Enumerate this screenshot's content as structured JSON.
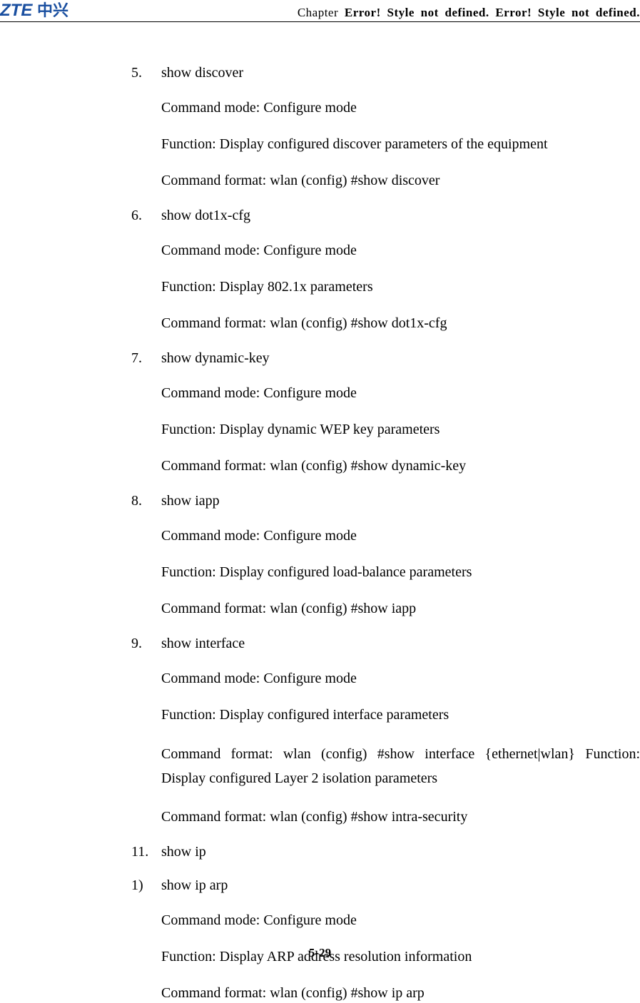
{
  "header": {
    "chapter_label": "Chapter",
    "error_text": "Error! Style not defined.  Error! Style not defined."
  },
  "items": [
    {
      "number": "5.",
      "title": "show discover",
      "lines": [
        "Command mode: Configure mode",
        "Function: Display configured discover parameters of the equipment",
        "Command format: wlan (config) #show discover"
      ]
    },
    {
      "number": "6.",
      "title": "show dot1x-cfg",
      "lines": [
        "Command mode: Configure mode",
        "Function: Display 802.1x parameters",
        "Command format: wlan (config) #show dot1x-cfg"
      ]
    },
    {
      "number": "7.",
      "title": "show dynamic-key",
      "lines": [
        "Command mode: Configure mode",
        "Function: Display dynamic WEP key parameters",
        "Command format: wlan (config) #show dynamic-key"
      ]
    },
    {
      "number": "8.",
      "title": "show iapp",
      "lines": [
        "Command mode: Configure mode",
        "Function: Display configured load-balance parameters",
        "Command format: wlan (config) #show iapp"
      ]
    },
    {
      "number": "9.",
      "title": "show interface",
      "lines": [
        "Command mode: Configure mode",
        "Function: Display configured interface parameters"
      ],
      "justify_line": "Command format: wlan (config) #show interface {ethernet|wlan} Function: Display configured Layer 2 isolation parameters",
      "lines_after": [
        "Command format: wlan (config) #show intra-security"
      ]
    },
    {
      "number": "11.",
      "title": "show ip",
      "lines": []
    },
    {
      "number": "1)",
      "title": "show ip arp",
      "lines": [
        "Command mode: Configure mode",
        "Function: Display ARP address resolution information",
        "Command format: wlan (config) #show ip arp"
      ]
    }
  ],
  "footer": {
    "page": "5-29"
  }
}
